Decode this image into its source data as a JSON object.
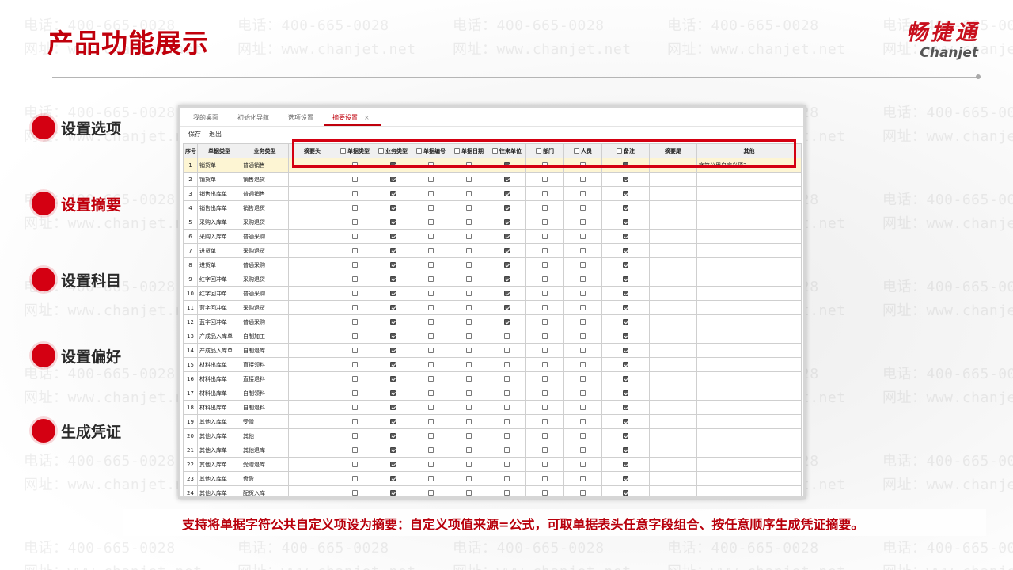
{
  "slide": {
    "title": "产品功能展示",
    "logo_cn": "畅捷通",
    "logo_en": "Chanjet",
    "caption": "支持将单据字符公共自定义项设为摘要：自定义项值来源=公式，可取单据表头任意字段组合、按任意顺序生成凭证摘要。"
  },
  "watermark": {
    "phone": "电话：400-665-0028",
    "site": "网址：www.chanjet.net"
  },
  "steps": [
    {
      "label": "设置选项",
      "active": false
    },
    {
      "label": "设置摘要",
      "active": true
    },
    {
      "label": "设置科目",
      "active": false
    },
    {
      "label": "设置偏好",
      "active": false
    },
    {
      "label": "生成凭证",
      "active": false
    }
  ],
  "colors": {
    "accent": "#c0000c",
    "highlight_row": "#fdf5d3"
  },
  "app": {
    "tabs": [
      {
        "label": "我的桌面",
        "active": false
      },
      {
        "label": "初始化导航",
        "active": false
      },
      {
        "label": "选项设置",
        "active": false
      },
      {
        "label": "摘要设置",
        "active": true
      }
    ],
    "tab_close_icon": "×",
    "toolbar": {
      "save": "保存",
      "exit": "退出"
    },
    "columns": [
      "序号",
      "单据类型",
      "业务类型",
      "摘要头",
      "单据类型",
      "业务类型",
      "单据编号",
      "单据日期",
      "往来单位",
      "部门",
      "人员",
      "备注",
      "摘要尾",
      "其他"
    ],
    "checkbox_column_indices": [
      4,
      5,
      6,
      7,
      8,
      9,
      10,
      11
    ],
    "rows": [
      {
        "no": "1",
        "doc": "销货单",
        "biz": "普通销售",
        "flags": [
          0,
          1,
          0,
          0,
          1,
          0,
          0,
          1
        ],
        "other": "字符公用自定义项3",
        "highlight": true
      },
      {
        "no": "2",
        "doc": "销货单",
        "biz": "销售退货",
        "flags": [
          0,
          1,
          0,
          0,
          1,
          0,
          0,
          1
        ],
        "other": ""
      },
      {
        "no": "3",
        "doc": "销售出库单",
        "biz": "普通销售",
        "flags": [
          0,
          1,
          0,
          0,
          1,
          0,
          0,
          1
        ],
        "other": ""
      },
      {
        "no": "4",
        "doc": "销售出库单",
        "biz": "销售退货",
        "flags": [
          0,
          1,
          0,
          0,
          1,
          0,
          0,
          1
        ],
        "other": ""
      },
      {
        "no": "5",
        "doc": "采购入库单",
        "biz": "采购退货",
        "flags": [
          0,
          1,
          0,
          0,
          1,
          0,
          0,
          1
        ],
        "other": ""
      },
      {
        "no": "6",
        "doc": "采购入库单",
        "biz": "普通采购",
        "flags": [
          0,
          1,
          0,
          0,
          1,
          0,
          0,
          1
        ],
        "other": ""
      },
      {
        "no": "7",
        "doc": "进货单",
        "biz": "采购退货",
        "flags": [
          0,
          1,
          0,
          0,
          1,
          0,
          0,
          1
        ],
        "other": ""
      },
      {
        "no": "8",
        "doc": "进货单",
        "biz": "普通采购",
        "flags": [
          0,
          1,
          0,
          0,
          1,
          0,
          0,
          1
        ],
        "other": ""
      },
      {
        "no": "9",
        "doc": "红字回冲单",
        "biz": "采购退货",
        "flags": [
          0,
          1,
          0,
          0,
          1,
          0,
          0,
          1
        ],
        "other": ""
      },
      {
        "no": "10",
        "doc": "红字回冲单",
        "biz": "普通采购",
        "flags": [
          0,
          1,
          0,
          0,
          1,
          0,
          0,
          1
        ],
        "other": ""
      },
      {
        "no": "11",
        "doc": "蓝字回冲单",
        "biz": "采购退货",
        "flags": [
          0,
          1,
          0,
          0,
          1,
          0,
          0,
          1
        ],
        "other": ""
      },
      {
        "no": "12",
        "doc": "蓝字回冲单",
        "biz": "普通采购",
        "flags": [
          0,
          1,
          0,
          0,
          1,
          0,
          0,
          1
        ],
        "other": ""
      },
      {
        "no": "13",
        "doc": "产成品入库单",
        "biz": "自制加工",
        "flags": [
          0,
          1,
          0,
          0,
          0,
          0,
          0,
          1
        ],
        "other": ""
      },
      {
        "no": "14",
        "doc": "产成品入库单",
        "biz": "自制退库",
        "flags": [
          0,
          1,
          0,
          0,
          0,
          0,
          0,
          1
        ],
        "other": ""
      },
      {
        "no": "15",
        "doc": "材料出库单",
        "biz": "直接领料",
        "flags": [
          0,
          1,
          0,
          0,
          0,
          0,
          0,
          1
        ],
        "other": ""
      },
      {
        "no": "16",
        "doc": "材料出库单",
        "biz": "直接退料",
        "flags": [
          0,
          1,
          0,
          0,
          0,
          0,
          0,
          1
        ],
        "other": ""
      },
      {
        "no": "17",
        "doc": "材料出库单",
        "biz": "自制领料",
        "flags": [
          0,
          1,
          0,
          0,
          0,
          0,
          0,
          1
        ],
        "other": ""
      },
      {
        "no": "18",
        "doc": "材料出库单",
        "biz": "自制退料",
        "flags": [
          0,
          1,
          0,
          0,
          0,
          0,
          0,
          1
        ],
        "other": ""
      },
      {
        "no": "19",
        "doc": "其他入库单",
        "biz": "受赠",
        "flags": [
          0,
          1,
          0,
          0,
          0,
          0,
          0,
          1
        ],
        "other": ""
      },
      {
        "no": "20",
        "doc": "其他入库单",
        "biz": "其他",
        "flags": [
          0,
          1,
          0,
          0,
          0,
          0,
          0,
          1
        ],
        "other": ""
      },
      {
        "no": "21",
        "doc": "其他入库单",
        "biz": "其他退库",
        "flags": [
          0,
          1,
          0,
          0,
          0,
          0,
          0,
          1
        ],
        "other": ""
      },
      {
        "no": "22",
        "doc": "其他入库单",
        "biz": "受赠退库",
        "flags": [
          0,
          1,
          0,
          0,
          0,
          0,
          0,
          1
        ],
        "other": ""
      },
      {
        "no": "23",
        "doc": "其他入库单",
        "biz": "盘盈",
        "flags": [
          0,
          1,
          0,
          0,
          0,
          0,
          0,
          1
        ],
        "other": ""
      },
      {
        "no": "24",
        "doc": "其他入库单",
        "biz": "配货入库",
        "flags": [
          0,
          1,
          0,
          0,
          0,
          0,
          0,
          1
        ],
        "other": ""
      }
    ]
  }
}
